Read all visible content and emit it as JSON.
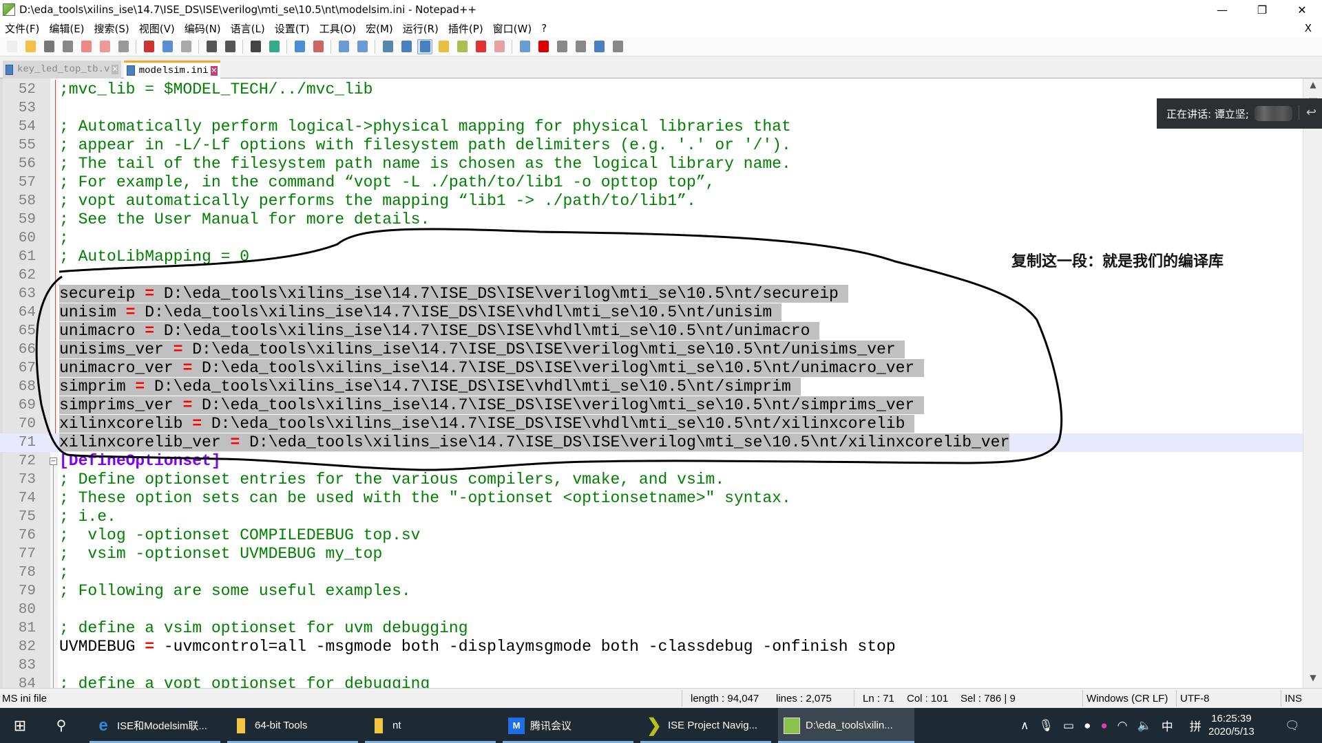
{
  "window": {
    "title": "D:\\eda_tools\\xilins_ise\\14.7\\ISE_DS\\ISE\\verilog\\mti_se\\10.5\\nt\\modelsim.ini - Notepad++",
    "minimize": "—",
    "restore": "❐",
    "close": "✕"
  },
  "menu": [
    "文件(F)",
    "编辑(E)",
    "搜索(S)",
    "视图(V)",
    "编码(N)",
    "语言(L)",
    "设置(T)",
    "工具(O)",
    "宏(M)",
    "运行(R)",
    "插件(P)",
    "窗口(W)",
    "?"
  ],
  "menu_close": "X",
  "toolbar_icons": [
    "new-file-icon",
    "open-file-icon",
    "save-icon",
    "save-all-icon",
    "close-icon",
    "close-all-icon",
    "print-icon",
    "cut-icon",
    "copy-icon",
    "paste-icon",
    "undo-icon",
    "redo-icon",
    "find-icon",
    "replace-icon",
    "zoom-in-icon",
    "zoom-out-icon",
    "sync-vertical-icon",
    "sync-horizontal-icon",
    "word-wrap-icon",
    "show-all-chars-icon",
    "indent-guide-icon",
    "user-language-icon",
    "doc-map-icon",
    "function-list-icon",
    "folder-workspace-icon",
    "monitoring-icon",
    "record-macro-icon",
    "stop-record-icon",
    "play-macro-icon",
    "run-macro-multiple-icon",
    "save-macro-icon"
  ],
  "tabs": [
    {
      "label": "key_led_top_tb.v",
      "active": false
    },
    {
      "label": "modelsim.ini",
      "active": true
    }
  ],
  "editor": {
    "lines": [
      {
        "n": "52",
        "segs": [
          {
            "t": "c",
            "x": ";mvc_lib = $MODEL_TECH/../mvc_lib"
          }
        ]
      },
      {
        "n": "53",
        "segs": []
      },
      {
        "n": "54",
        "segs": [
          {
            "t": "c",
            "x": "; Automatically perform logical->physical mapping for physical libraries that"
          }
        ]
      },
      {
        "n": "55",
        "segs": [
          {
            "t": "c",
            "x": "; appear in -L/-Lf options with filesystem path delimiters (e.g. '.' or '/')."
          }
        ]
      },
      {
        "n": "56",
        "segs": [
          {
            "t": "c",
            "x": "; The tail of the filesystem path name is chosen as the logical library name."
          }
        ]
      },
      {
        "n": "57",
        "segs": [
          {
            "t": "c",
            "x": "; For example, in the command “vopt -L ./path/to/lib1 -o opttop top”,"
          }
        ]
      },
      {
        "n": "58",
        "segs": [
          {
            "t": "c",
            "x": "; vopt automatically performs the mapping “lib1 -> ./path/to/lib1”."
          }
        ]
      },
      {
        "n": "59",
        "segs": [
          {
            "t": "c",
            "x": "; See the User Manual for more details."
          }
        ]
      },
      {
        "n": "60",
        "segs": [
          {
            "t": "c",
            "x": ";"
          }
        ]
      },
      {
        "n": "61",
        "segs": [
          {
            "t": "c",
            "x": "; AutoLibMapping = 0"
          }
        ]
      },
      {
        "n": "62",
        "segs": []
      },
      {
        "n": "63",
        "sel": true,
        "segs": [
          {
            "t": "k",
            "x": "secureip "
          },
          {
            "t": "o",
            "x": "="
          },
          {
            "t": "v",
            "x": " D:\\eda_tools\\xilins_ise\\14.7\\ISE_DS\\ISE\\verilog\\mti_se\\10.5\\nt/secureip "
          }
        ]
      },
      {
        "n": "64",
        "sel": true,
        "segs": [
          {
            "t": "k",
            "x": "unisim "
          },
          {
            "t": "o",
            "x": "="
          },
          {
            "t": "v",
            "x": " D:\\eda_tools\\xilins_ise\\14.7\\ISE_DS\\ISE\\vhdl\\mti_se\\10.5\\nt/unisim "
          }
        ]
      },
      {
        "n": "65",
        "sel": true,
        "segs": [
          {
            "t": "k",
            "x": "unimacro "
          },
          {
            "t": "o",
            "x": "="
          },
          {
            "t": "v",
            "x": " D:\\eda_tools\\xilins_ise\\14.7\\ISE_DS\\ISE\\vhdl\\mti_se\\10.5\\nt/unimacro "
          }
        ]
      },
      {
        "n": "66",
        "sel": true,
        "segs": [
          {
            "t": "k",
            "x": "unisims_ver "
          },
          {
            "t": "o",
            "x": "="
          },
          {
            "t": "v",
            "x": " D:\\eda_tools\\xilins_ise\\14.7\\ISE_DS\\ISE\\verilog\\mti_se\\10.5\\nt/unisims_ver "
          }
        ]
      },
      {
        "n": "67",
        "sel": true,
        "segs": [
          {
            "t": "k",
            "x": "unimacro_ver "
          },
          {
            "t": "o",
            "x": "="
          },
          {
            "t": "v",
            "x": " D:\\eda_tools\\xilins_ise\\14.7\\ISE_DS\\ISE\\verilog\\mti_se\\10.5\\nt/unimacro_ver "
          }
        ]
      },
      {
        "n": "68",
        "sel": true,
        "segs": [
          {
            "t": "k",
            "x": "simprim "
          },
          {
            "t": "o",
            "x": "="
          },
          {
            "t": "v",
            "x": " D:\\eda_tools\\xilins_ise\\14.7\\ISE_DS\\ISE\\vhdl\\mti_se\\10.5\\nt/simprim "
          }
        ]
      },
      {
        "n": "69",
        "sel": true,
        "segs": [
          {
            "t": "k",
            "x": "simprims_ver "
          },
          {
            "t": "o",
            "x": "="
          },
          {
            "t": "v",
            "x": " D:\\eda_tools\\xilins_ise\\14.7\\ISE_DS\\ISE\\verilog\\mti_se\\10.5\\nt/simprims_ver "
          }
        ]
      },
      {
        "n": "70",
        "sel": true,
        "segs": [
          {
            "t": "k",
            "x": "xilinxcorelib "
          },
          {
            "t": "o",
            "x": "="
          },
          {
            "t": "v",
            "x": " D:\\eda_tools\\xilins_ise\\14.7\\ISE_DS\\ISE\\vhdl\\mti_se\\10.5\\nt/xilinxcorelib "
          }
        ]
      },
      {
        "n": "71",
        "sel": true,
        "cur": true,
        "segs": [
          {
            "t": "k",
            "x": "xilinxcorelib_ver "
          },
          {
            "t": "o",
            "x": "="
          },
          {
            "t": "v",
            "x": " D:\\eda_tools\\xilins_ise\\14.7\\ISE_DS\\ISE\\verilog\\mti_se\\10.5\\nt/xilinxcorelib_ver"
          }
        ]
      },
      {
        "n": "72",
        "fold": true,
        "segs": [
          {
            "t": "s",
            "x": "[DefineOptionset]"
          }
        ]
      },
      {
        "n": "73",
        "segs": [
          {
            "t": "c",
            "x": "; Define optionset entries for the various compilers, vmake, and vsim."
          }
        ]
      },
      {
        "n": "74",
        "segs": [
          {
            "t": "c",
            "x": "; These option sets can be used with the \"-optionset <optionsetname>\" syntax."
          }
        ]
      },
      {
        "n": "75",
        "segs": [
          {
            "t": "c",
            "x": "; i.e."
          }
        ]
      },
      {
        "n": "76",
        "segs": [
          {
            "t": "c",
            "x": ";  vlog -optionset COMPILEDEBUG top.sv"
          }
        ]
      },
      {
        "n": "77",
        "segs": [
          {
            "t": "c",
            "x": ";  vsim -optionset UVMDEBUG my_top"
          }
        ]
      },
      {
        "n": "78",
        "segs": [
          {
            "t": "c",
            "x": ";"
          }
        ]
      },
      {
        "n": "79",
        "segs": [
          {
            "t": "c",
            "x": "; Following are some useful examples."
          }
        ]
      },
      {
        "n": "80",
        "segs": []
      },
      {
        "n": "81",
        "segs": [
          {
            "t": "c",
            "x": "; define a vsim optionset for uvm debugging"
          }
        ]
      },
      {
        "n": "82",
        "segs": [
          {
            "t": "k",
            "x": "UVMDEBUG "
          },
          {
            "t": "o",
            "x": "="
          },
          {
            "t": "v",
            "x": " -uvmcontrol=all -msgmode both -displaymsgmode both -classdebug -onfinish stop"
          }
        ]
      },
      {
        "n": "83",
        "segs": []
      },
      {
        "n": "84",
        "segs": [
          {
            "t": "c",
            "x": "; define a vopt optionset for debugging"
          }
        ]
      }
    ]
  },
  "annotation": {
    "note": "复制这一段：就是我们的编译库"
  },
  "speaking_overlay": {
    "label": "正在讲话: 谭立坚;"
  },
  "statusbar": {
    "filetype": "MS ini file",
    "length": "length : 94,047",
    "lines": "lines : 2,075",
    "ln": "Ln : 71",
    "col": "Col : 101",
    "sel": "Sel : 786 | 9",
    "eol": "Windows (CR LF)",
    "encoding": "UTF-8",
    "mode": "INS"
  },
  "taskbar": {
    "items": [
      {
        "label": "ISE和Modelsim联...",
        "icon": "edge-browser-icon"
      },
      {
        "label": "64-bit Tools",
        "icon": "folder-icon"
      },
      {
        "label": "nt",
        "icon": "folder-icon"
      },
      {
        "label": "腾讯会议",
        "icon": "tencent-meeting-icon"
      },
      {
        "label": "ISE Project Navig...",
        "icon": "ise-icon"
      },
      {
        "label": "D:\\eda_tools\\xilin...",
        "icon": "notepadpp-icon"
      }
    ],
    "ime_lang": "中",
    "ime_mode": "拼",
    "time": "16:25:39",
    "date": "2020/5/13"
  },
  "colors": {
    "comment": "#008000",
    "operator": "#ff0000",
    "section": "#8000ff",
    "selection": "#c0c0c0",
    "current_line": "#e8e8ff",
    "tab_active_accent": "#f5a623"
  }
}
